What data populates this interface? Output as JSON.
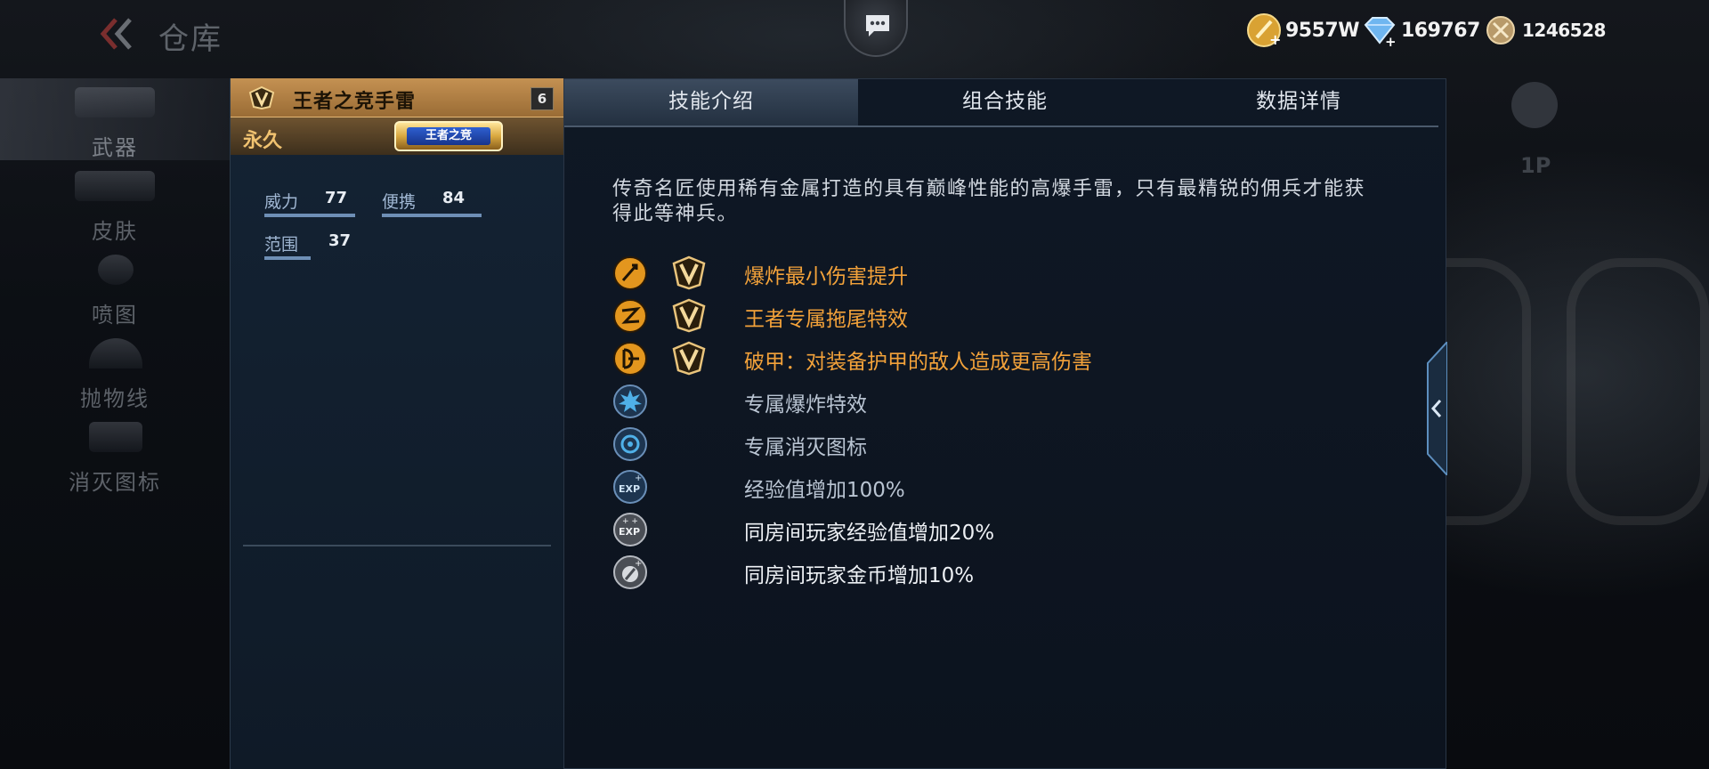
{
  "header": {
    "title": "仓库",
    "currencies": [
      {
        "icon": "gold-coin-icon",
        "value": "9557W"
      },
      {
        "icon": "diamond-icon",
        "value": "169767"
      },
      {
        "icon": "honor-coin-icon",
        "value": "1246528"
      }
    ]
  },
  "background": {
    "right_label": "1P"
  },
  "nav": [
    {
      "label": "武器",
      "active": true
    },
    {
      "label": "皮肤"
    },
    {
      "label": "喷图"
    },
    {
      "label": "抛物线"
    },
    {
      "label": "消灭图标"
    }
  ],
  "item": {
    "name": "王者之竞手雷",
    "level": "6",
    "duration": "永久",
    "badge": "王者之竞",
    "stats": [
      {
        "label": "威力",
        "value": "77"
      },
      {
        "label": "便携",
        "value": "84"
      },
      {
        "label": "范围",
        "value": "37"
      }
    ]
  },
  "tabs": [
    {
      "label": "技能介绍",
      "active": true
    },
    {
      "label": "组合技能"
    },
    {
      "label": "数据详情"
    }
  ],
  "description": "传奇名匠使用稀有金属打造的具有巅峰性能的高爆手雷，只有最精锐的佣兵才能获得此等神兵。",
  "skills": [
    {
      "icon": "explosion-damage-icon",
      "vip": true,
      "text": "爆炸最小伤害提升",
      "color": "gold"
    },
    {
      "icon": "trail-effect-icon",
      "vip": true,
      "text": "王者专属拖尾特效",
      "color": "gold"
    },
    {
      "icon": "armor-break-icon",
      "vip": true,
      "text": "破甲：对装备护甲的敌人造成更高伤害",
      "color": "gold"
    },
    {
      "icon": "explosion-effect-icon",
      "vip": false,
      "text": "专属爆炸特效",
      "color": "blue"
    },
    {
      "icon": "kill-icon-icon",
      "vip": false,
      "text": "专属消灭图标",
      "color": "blue"
    },
    {
      "icon": "exp-boost-icon",
      "vip": false,
      "text": "经验值增加100%",
      "color": "blue"
    },
    {
      "icon": "room-exp-icon",
      "vip": false,
      "text": "同房间玩家经验值增加20%",
      "color": "white"
    },
    {
      "icon": "room-gold-icon",
      "vip": false,
      "text": "同房间玩家金币增加10%",
      "color": "white"
    }
  ],
  "colors": {
    "gold": "#f3a23a",
    "accent_blue": "#6e8fb6",
    "panel": "#0f1825"
  }
}
